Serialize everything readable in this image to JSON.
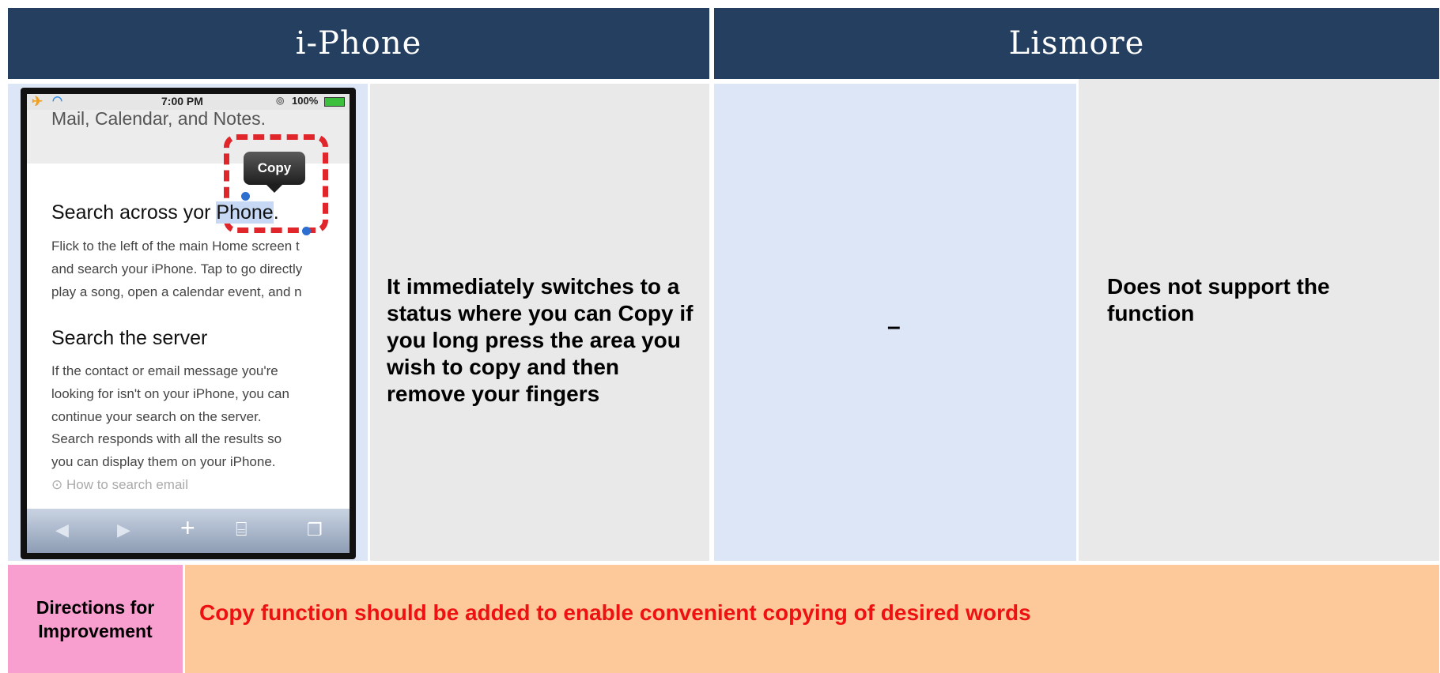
{
  "header": {
    "left_title": "i-Phone",
    "right_title": "Lismore"
  },
  "iphone": {
    "description": "It immediately switches to a status where you can Copy if you long press the area you wish to copy and then remove your fingers",
    "screenshot": {
      "status_time": "7:00 PM",
      "battery": "100%",
      "top_text": "Mail, Calendar, and Notes.",
      "copy_label": "Copy",
      "heading1_prefix": "Search across yo",
      "heading1_mid": "r ",
      "heading1_selected": "Phone",
      "heading1_suffix": ".",
      "para1": [
        "Flick to the left of the main Home screen t",
        "and search your iPhone. Tap to go directly",
        "play a song, open a calendar event, and n"
      ],
      "heading2": "Search the server",
      "para2": [
        "If the contact or email message you're",
        "looking for isn't on your iPhone, you can",
        "continue your search on the server.",
        "Search responds with all the results so",
        "you can display them on your iPhone."
      ],
      "link_text": "How to search email",
      "accent_red": "#e0262b",
      "selection_blue": "#2d6fd1"
    }
  },
  "lismore": {
    "value": "–",
    "description": "Does not support the function"
  },
  "improvement": {
    "label": "Directions for Improvement",
    "text": "Copy function should be added to enable convenient copying of desired words"
  },
  "colors": {
    "header_bg": "#243f60",
    "label_bg": "#f99fcf",
    "improvement_bg": "#fdc89a",
    "improvement_text": "#ee1111",
    "light_blue": "#dde6f7",
    "light_gray": "#e9e9e9"
  }
}
